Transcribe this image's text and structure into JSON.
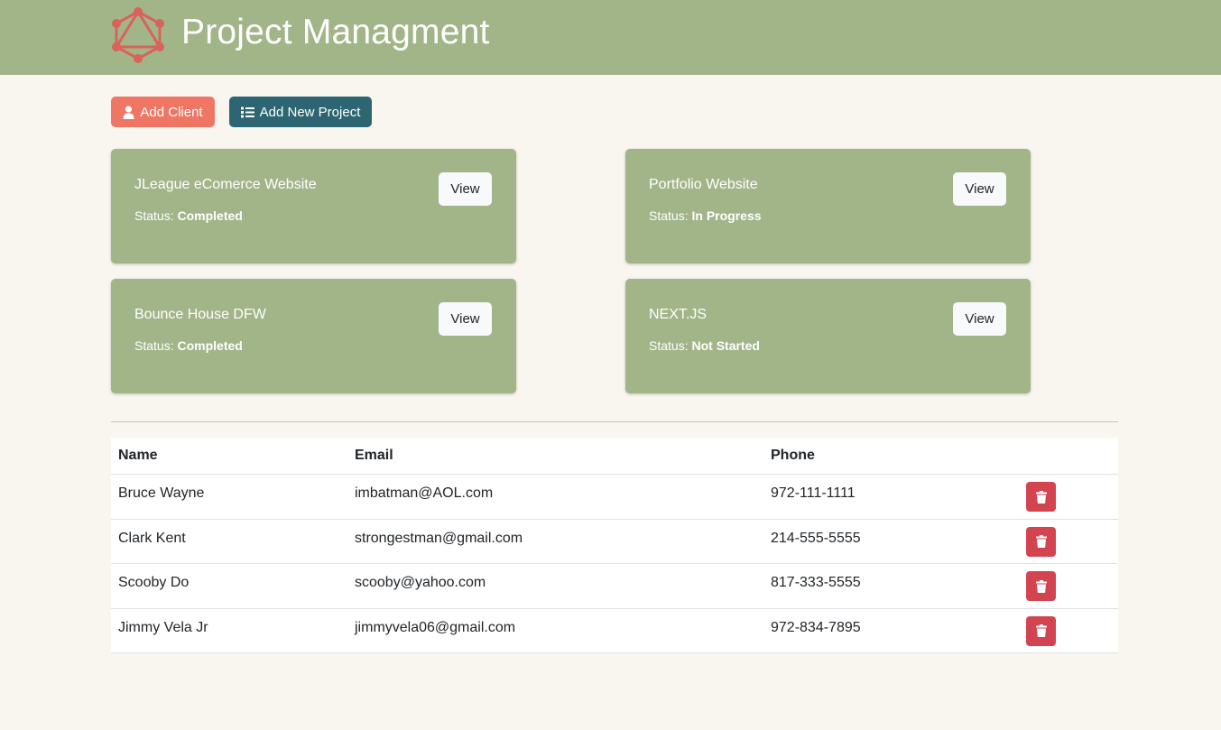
{
  "app": {
    "title": "Project Managment",
    "logo_icon": "graphql-logo-icon",
    "colors": {
      "header": "#a2b589",
      "background": "#f9f6ef",
      "add_client": "#ef7664",
      "add_project": "#2d6672",
      "delete": "#d2444f"
    }
  },
  "toolbar": {
    "add_client_label": "Add Client",
    "add_client_icon": "user-icon",
    "add_project_label": "Add New Project",
    "add_project_icon": "list-icon"
  },
  "projects": [
    {
      "name": "JLeague eComerce Website",
      "status_label": "Status:",
      "status": "Completed",
      "view_label": "View"
    },
    {
      "name": "Portfolio Website",
      "status_label": "Status:",
      "status": "In Progress",
      "view_label": "View"
    },
    {
      "name": "Bounce House DFW",
      "status_label": "Status:",
      "status": "Completed",
      "view_label": "View"
    },
    {
      "name": "NEXT.JS",
      "status_label": "Status:",
      "status": "Not Started",
      "view_label": "View"
    }
  ],
  "clients_table": {
    "headers": {
      "name": "Name",
      "email": "Email",
      "phone": "Phone"
    },
    "rows": [
      {
        "name": "Bruce Wayne",
        "email": "imbatman@AOL.com",
        "phone": "972-111-1111",
        "delete_icon": "trash-icon"
      },
      {
        "name": "Clark Kent",
        "email": "strongestman@gmail.com",
        "phone": "214-555-5555",
        "delete_icon": "trash-icon"
      },
      {
        "name": "Scooby Do",
        "email": "scooby@yahoo.com",
        "phone": "817-333-5555",
        "delete_icon": "trash-icon"
      },
      {
        "name": "Jimmy Vela Jr",
        "email": "jimmyvela06@gmail.com",
        "phone": "972-834-7895",
        "delete_icon": "trash-icon"
      }
    ]
  }
}
